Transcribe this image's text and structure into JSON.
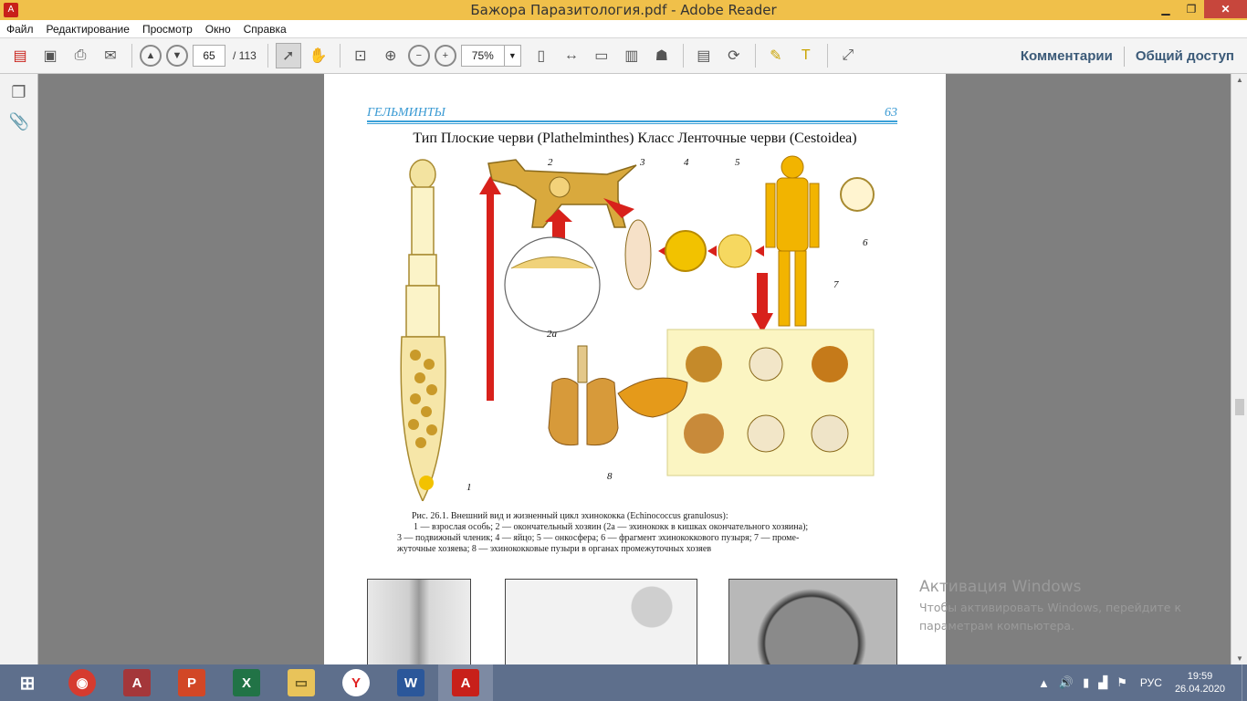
{
  "window": {
    "title": "Бажора Паразитология.pdf - Adobe Reader"
  },
  "menu": [
    "Файл",
    "Редактирование",
    "Просмотр",
    "Окно",
    "Справка"
  ],
  "toolbar": {
    "page_current": "65",
    "page_total": "/ 113",
    "zoom": "75%",
    "comments": "Комментарии",
    "share": "Общий доступ"
  },
  "page": {
    "header_left": "ГЕЛЬМИНТЫ",
    "header_right": "63",
    "title": "Тип Плоские черви (Plathelminthes) Класс Ленточные черви (Cestoidea)",
    "figure_labels": {
      "l1": "1",
      "l2": "2",
      "l2a": "2а",
      "l3": "3",
      "l4": "4",
      "l5": "5",
      "l6": "6",
      "l7": "7",
      "l8": "8"
    },
    "caption": {
      "line1": "Рис. 26.1. Внешний вид и жизненный цикл эхинококка (Echinococcus granulosus):",
      "line2": "1 — взрослая особь; 2 — окончательный хозяин (2а — эхинококк в кишках окончательного хозяина);",
      "line3": "3 — подвижный членик; 4 — яйцо; 5 — онкосфера; 6 — фрагмент эхинококкового пузыря; 7 — проме-",
      "line4": "жуточные хозяева; 8 — эхинококковые пузыри в органах промежуточных хозяев"
    }
  },
  "activation": {
    "title": "Активация Windows",
    "line1": "Чтобы активировать Windows, перейдите к",
    "line2": "параметрам компьютера."
  },
  "taskbar": {
    "apps": [
      {
        "name": "chrome",
        "color": "#d63b2f",
        "glyph": "◉"
      },
      {
        "name": "access",
        "color": "#a4373a",
        "glyph": "A"
      },
      {
        "name": "powerpoint",
        "color": "#d24726",
        "glyph": "P"
      },
      {
        "name": "excel",
        "color": "#217346",
        "glyph": "X"
      },
      {
        "name": "explorer",
        "color": "#e8c35a",
        "glyph": "▭"
      },
      {
        "name": "yandex",
        "color": "#ffffff",
        "glyph": "Y"
      },
      {
        "name": "word",
        "color": "#2b579a",
        "glyph": "W"
      },
      {
        "name": "adobe-reader",
        "color": "#c8201a",
        "glyph": "A"
      }
    ],
    "lang": "РУС",
    "time": "19:59",
    "date": "26.04.2020"
  }
}
